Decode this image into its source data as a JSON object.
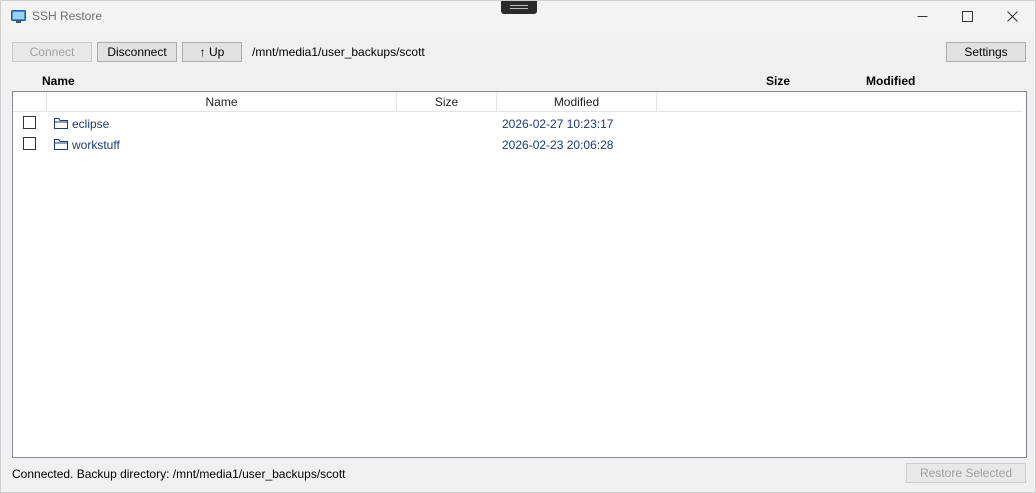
{
  "window": {
    "title": "SSH Restore"
  },
  "toolbar": {
    "connect_label": "Connect",
    "disconnect_label": "Disconnect",
    "up_label": "↑ Up",
    "path": "/mnt/media1/user_backups/scott",
    "settings_label": "Settings"
  },
  "outer_headers": {
    "name": "Name",
    "size": "Size",
    "modified": "Modified"
  },
  "list": {
    "columns": {
      "name": "Name",
      "size": "Size",
      "modified": "Modified"
    },
    "rows": [
      {
        "name": "eclipse",
        "size": "",
        "modified": "2026-02-27 10:23:17",
        "checked": false,
        "icon": "folder-icon"
      },
      {
        "name": "workstuff",
        "size": "",
        "modified": "2026-02-23 20:06:28",
        "checked": false,
        "icon": "folder-icon"
      }
    ]
  },
  "status": {
    "text": "Connected. Backup directory: /mnt/media1/user_backups/scott",
    "restore_label": "Restore Selected"
  },
  "colors": {
    "link_text": "#1c3b7a",
    "button_bg": "#e1e1e1",
    "window_bg": "#f0f0f0"
  }
}
